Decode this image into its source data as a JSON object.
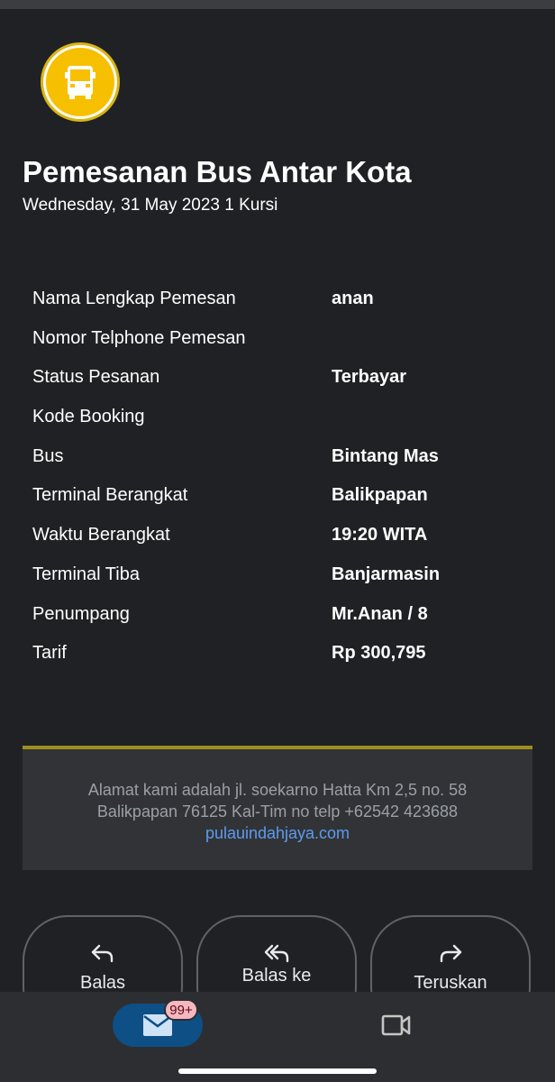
{
  "email": {
    "title": "Pemesanan Bus Antar Kota",
    "subtitle": "Wednesday, 31 May 2023 1 Kursi",
    "details": [
      {
        "label": "Nama Lengkap Pemesan",
        "value": "anan"
      },
      {
        "label": "Nomor Telphone Pemesan",
        "value": ""
      },
      {
        "label": "Status Pesanan",
        "value": "Terbayar"
      },
      {
        "label": "Kode Booking",
        "value": ""
      },
      {
        "label": "Bus",
        "value": "Bintang Mas"
      },
      {
        "label": "Terminal Berangkat",
        "value": "Balikpapan"
      },
      {
        "label": "Waktu Berangkat",
        "value": "19:20 WITA"
      },
      {
        "label": "Terminal Tiba",
        "value": "Banjarmasin"
      },
      {
        "label": "Penumpang",
        "value": "Mr.Anan / 8"
      },
      {
        "label": "Tarif",
        "value": "Rp 300,795"
      }
    ],
    "footer": {
      "line1": "Alamat kami adalah jl. soekarno Hatta Km 2,5 no. 58",
      "line2": "Balikpapan 76125 Kal-Tim no telp +62542 423688",
      "link": "pulauindahjaya.com"
    },
    "logo_icon": "bus-icon"
  },
  "actions": {
    "reply": "Balas",
    "reply_all": "Balas ke",
    "forward": "Teruskan"
  },
  "bottom_nav": {
    "mail_badge": "99+",
    "mail_icon": "mail-icon",
    "meet_icon": "video-camera-icon"
  },
  "colors": {
    "background": "#202124",
    "accent_line": "#a08e1e",
    "link": "#5b9cf0",
    "mail_pill": "#0e4f86",
    "badge": "#f6b8bf",
    "logo_yellow": "#f6c000"
  }
}
